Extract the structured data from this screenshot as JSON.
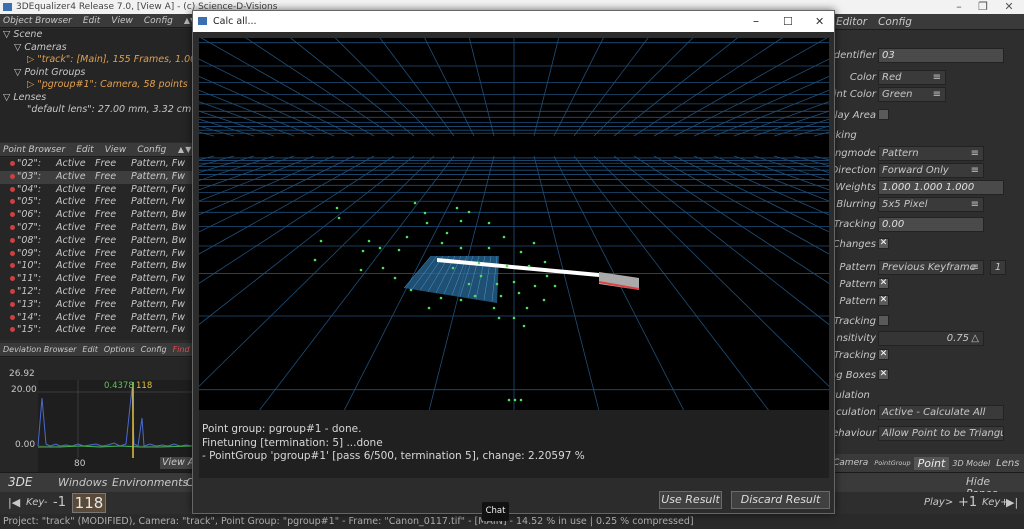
{
  "app": {
    "title": "3DEqualizer4 Release 7.0, [View A]  -  (c) Science-D-Visions"
  },
  "object_browser": {
    "menu": [
      "Object Browser",
      "Edit",
      "View",
      "Config"
    ],
    "tree": [
      "Scene",
      "Cameras",
      "\"track\": [Main], 155 Frames, 1.00,",
      "Point Groups",
      "\"pgroup#1\": Camera, 58 points",
      "Lenses",
      "\"default lens\": 27.00 mm, 3.32 cm x 1"
    ]
  },
  "point_browser": {
    "menu": [
      "Point Browser",
      "Edit",
      "View",
      "Config"
    ],
    "rows": [
      {
        "name": "\"02\":",
        "status": "Active",
        "mode": "Free",
        "type": "Pattern, Fw"
      },
      {
        "name": "\"03\":",
        "status": "Active",
        "mode": "Free",
        "type": "Pattern, Fw"
      },
      {
        "name": "\"04\":",
        "status": "Active",
        "mode": "Free",
        "type": "Pattern, Fw"
      },
      {
        "name": "\"05\":",
        "status": "Active",
        "mode": "Free",
        "type": "Pattern, Fw"
      },
      {
        "name": "\"06\":",
        "status": "Active",
        "mode": "Free",
        "type": "Pattern, Bw"
      },
      {
        "name": "\"07\":",
        "status": "Active",
        "mode": "Free",
        "type": "Pattern, Bw"
      },
      {
        "name": "\"08\":",
        "status": "Active",
        "mode": "Free",
        "type": "Pattern, Bw"
      },
      {
        "name": "\"09\":",
        "status": "Active",
        "mode": "Free",
        "type": "Pattern, Fw"
      },
      {
        "name": "\"10\":",
        "status": "Active",
        "mode": "Free",
        "type": "Pattern, Bw"
      },
      {
        "name": "\"11\":",
        "status": "Active",
        "mode": "Free",
        "type": "Pattern, Fw"
      },
      {
        "name": "\"12\":",
        "status": "Active",
        "mode": "Free",
        "type": "Pattern, Fw"
      },
      {
        "name": "\"13\":",
        "status": "Active",
        "mode": "Free",
        "type": "Pattern, Fw"
      },
      {
        "name": "\"14\":",
        "status": "Active",
        "mode": "Free",
        "type": "Pattern, Fw"
      },
      {
        "name": "\"15\":",
        "status": "Active",
        "mode": "Free",
        "type": "Pattern, Fw"
      }
    ]
  },
  "deviation_browser": {
    "menu": [
      "Deviation Browser",
      "Edit",
      "Options",
      "Config",
      "Find"
    ],
    "y_top": "26.92",
    "y_mid": "20.00",
    "y_low": "0.00",
    "x_tick": "80",
    "marker_value": "0.4378",
    "marker_frame": "118",
    "view_all": "View A"
  },
  "attribute_editor": {
    "header": [
      "Editor",
      "Config"
    ],
    "identifier_label": "Identifier",
    "identifier_value": "03",
    "color_label": "Color",
    "color_value": "Red",
    "point_color_label": "int Color",
    "point_color_value": "Green",
    "play_area_label": "play Area",
    "tracking_section": "cking",
    "trackmode_label": "ngmode",
    "trackmode_value": "Pattern",
    "direction_label": "Direction",
    "direction_value": "Forward Only",
    "weights_label": "Weights",
    "weights_value": "1.000 1.000 1.000",
    "blurring_label": "Blurring",
    "blurring_value": "5x5 Pixel",
    "tracking_label": "Tracking",
    "tracking_value": "0.00",
    "changes_label": "Changes",
    "pattern_label": "Pattern",
    "pattern_value": "Previous Keyframe",
    "pattern_num": "1",
    "pattern2_label": "Pattern",
    "pattern3_label": "Pattern",
    "tracking2_label": "Tracking",
    "sensitivity_label": "nsitivity",
    "sensitivity_value": "0.75",
    "tracking3_label": "Tracking",
    "boxes_label": "ng Boxes",
    "calc_section": "culation",
    "calc_label": "culation",
    "calc_value": "Active - Calculate All",
    "behaviour_label": "ehaviour",
    "behaviour_value": "Allow Point to be Triangulat",
    "tabs": [
      "Camera",
      "PointGroup",
      "Point",
      "3D Model",
      "Lens"
    ]
  },
  "dialog": {
    "title": "Calc all...",
    "log": [
      "Point group: pgroup#1 - done.",
      "Finetuning [termination: 5] ...done",
      "- PointGroup 'pgroup#1'  [pass 6/500, termination 5], change: 2.20597 %"
    ],
    "use_result": "Use Result",
    "discard_result": "Discard Result"
  },
  "bottom": {
    "tabs": [
      "3DE",
      "Windows",
      "Environments",
      "C"
    ],
    "hide_panes": "Hide Panes",
    "key_minus": "Key-",
    "minus_one": "-1",
    "frame": "118",
    "play": "Play>",
    "plus_one": "+1",
    "key_plus": "Key+"
  },
  "status": "Project: \"track\" (MODIFIED), Camera: \"track\", Point Group: \"pgroup#1\" - Frame: \"Canon_0117.tif\" - [MAIN] - 14.52 % in use | 0.25 % compressed]",
  "tooltip": "Chat",
  "colors": {
    "viewport_grid": "#1f4f7a",
    "point_marker": "#4fe060",
    "track_bar": "#ffffff",
    "track_end": "#e04040",
    "deviation_curve": "#4a6ad0",
    "deviation_marker": "#e0c040"
  }
}
